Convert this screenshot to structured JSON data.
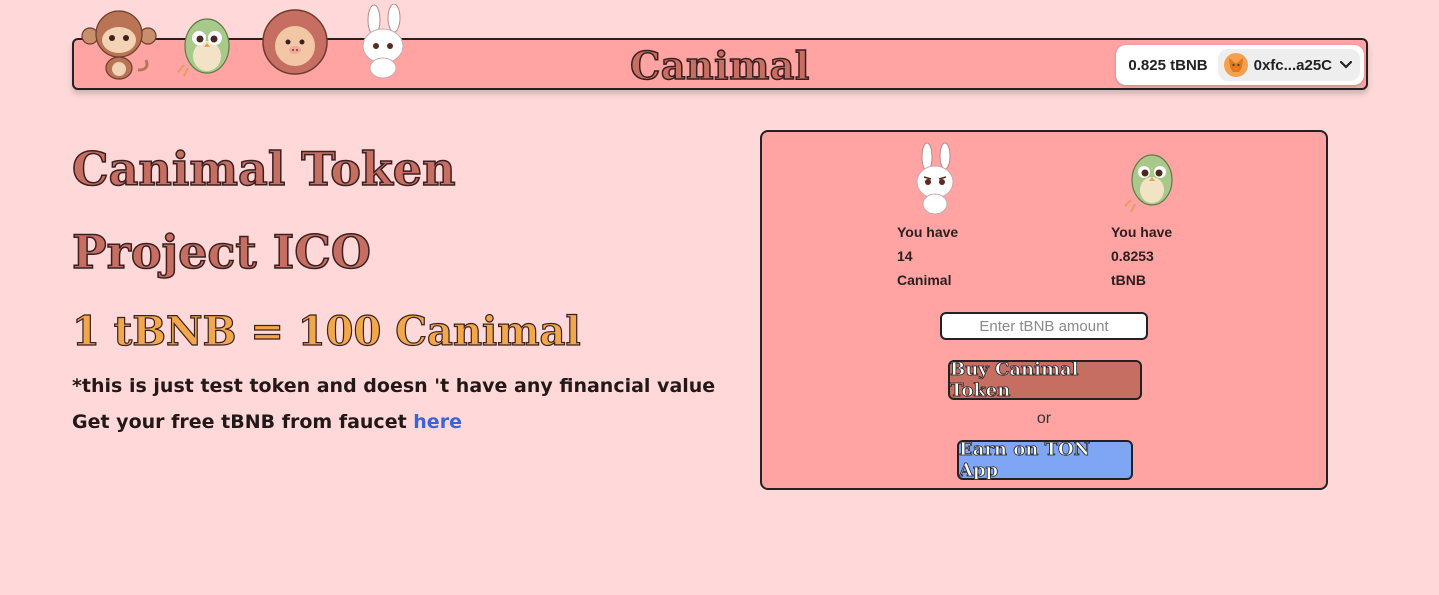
{
  "header": {
    "brand": "Canimal",
    "wallet": {
      "balance": "0.825 tBNB",
      "address": "0xfc...a25C"
    }
  },
  "hero": {
    "title_line1": "Canimal Token",
    "title_line2": "Project ICO",
    "rate": "1 tBNB = 100 Canimal",
    "disclaimer": "*this is just test token and doesn 't have any financial value",
    "faucet_prefix": "Get your free tBNB from faucet ",
    "faucet_link": "here"
  },
  "card": {
    "canimal_holding": {
      "label": "You have",
      "amount": "14",
      "unit": "Canimal"
    },
    "tbnb_holding": {
      "label": "You have",
      "amount": "0.8253",
      "unit": "tBNB"
    },
    "amount_placeholder": "Enter tBNB amount",
    "buy_label": "Buy Canimal Token",
    "or_label": "or",
    "earn_label": "Earn on TON App"
  },
  "colors": {
    "background": "#ffd9d9",
    "panel": "#ffa3a3",
    "brand": "#c56e61",
    "rate": "#f2a84a",
    "link": "#3d63d8",
    "earn_button": "#7fa6f5"
  },
  "icons": [
    "monkey-mascot-icon",
    "owl-mascot-icon",
    "hedgehog-mascot-icon",
    "bunny-mascot-icon",
    "metamask-fox-icon",
    "chevron-down-icon"
  ]
}
